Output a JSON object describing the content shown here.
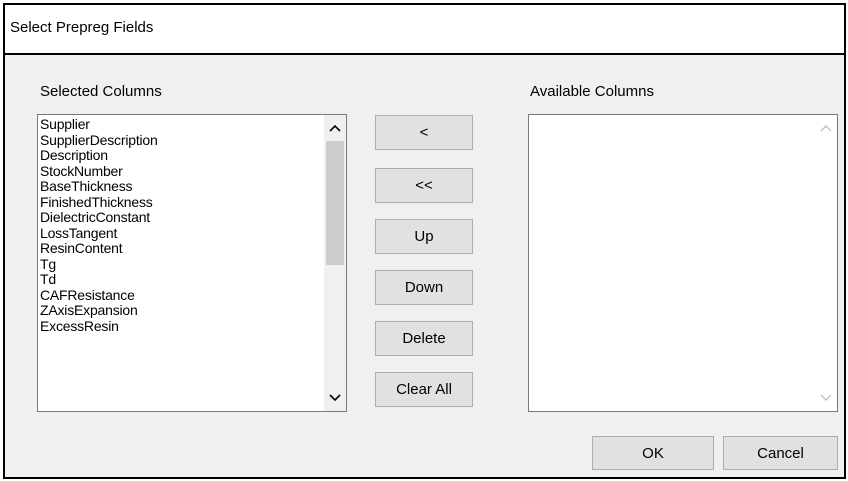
{
  "dialog": {
    "title": "Select Prepreg Fields"
  },
  "selected": {
    "label": "Selected Columns",
    "items": [
      "Supplier",
      "SupplierDescription",
      "Description",
      "StockNumber",
      "BaseThickness",
      "FinishedThickness",
      "DielectricConstant",
      "LossTangent",
      "ResinContent",
      "Tg",
      "Td",
      "CAFResistance",
      "ZAxisExpansion",
      "ExcessResin"
    ]
  },
  "available": {
    "label": "Available Columns",
    "items": []
  },
  "buttons": {
    "move_left": "<",
    "move_all_left": "<<",
    "up": "Up",
    "down": "Down",
    "delete": "Delete",
    "clear_all": "Clear All",
    "ok": "OK",
    "cancel": "Cancel"
  },
  "icons": {
    "scroll_up": "chevron-up-icon",
    "scroll_down": "chevron-down-icon"
  },
  "colors": {
    "dialog_bg": "#f0f0f0",
    "button_bg": "#e1e1e1",
    "scroll_thumb": "#cdcdcd",
    "disabled_arrow": "#c0c0c0"
  }
}
